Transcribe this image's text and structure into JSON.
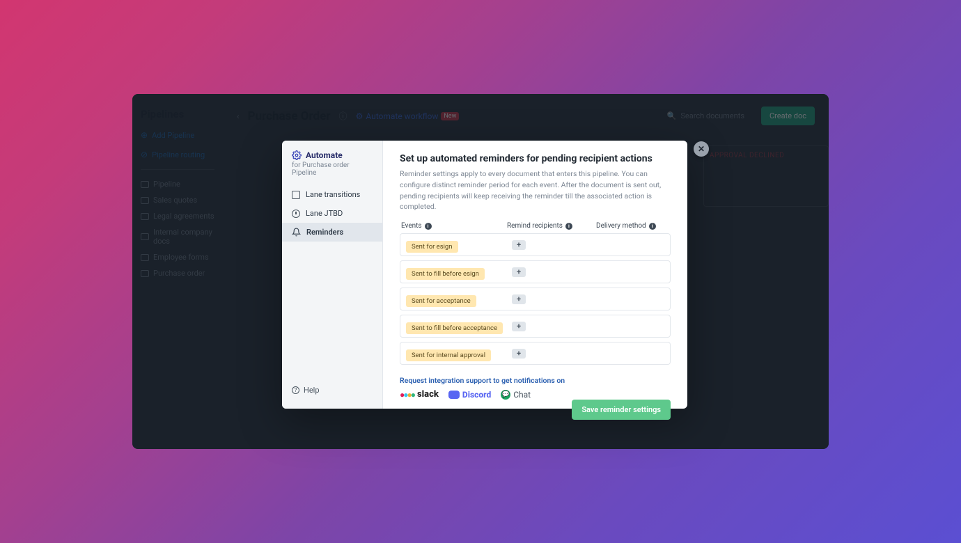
{
  "bg": {
    "sidebar_title": "Pipelines",
    "add_pipeline": "Add Pipeline",
    "pipeline_routing": "Pipeline routing",
    "nav": [
      "Pipeline",
      "Sales quotes",
      "Legal agreements",
      "Internal company docs",
      "Employee forms",
      "Purchase order"
    ],
    "header_title": "Purchase Order",
    "automate_link": "Automate workflow",
    "new_badge": "New",
    "search_placeholder": "Search documents",
    "create_button": "Create doc",
    "lane_label": "APPROVAL DECLINED"
  },
  "close_glyph": "✕",
  "modal_sidebar": {
    "title": "Automate",
    "subtitle": "for Purchase order Pipeline",
    "items": [
      {
        "label": "Lane transitions"
      },
      {
        "label": "Lane JTBD"
      },
      {
        "label": "Reminders"
      }
    ],
    "help": "Help"
  },
  "modal": {
    "title": "Set up automated reminders for pending recipient actions",
    "description": "Reminder settings apply to every document that enters this pipeline. You can configure distinct reminder period for each event. After the document is sent out, pending recipients will keep receiving the reminder till the associated action is completed.",
    "col_events": "Events",
    "col_recipients": "Remind recipients",
    "col_delivery": "Delivery method",
    "info_glyph": "i",
    "events": [
      "Sent for esign",
      "Sent to fill before esign",
      "Sent for acceptance",
      "Sent to fill before acceptance",
      "Sent for internal approval"
    ],
    "add_glyph": "+",
    "integration_label": "Request integration support to get notifications on",
    "slack_label": "slack",
    "discord_label": "Discord",
    "chat_label": "Chat",
    "save_button": "Save reminder settings"
  }
}
